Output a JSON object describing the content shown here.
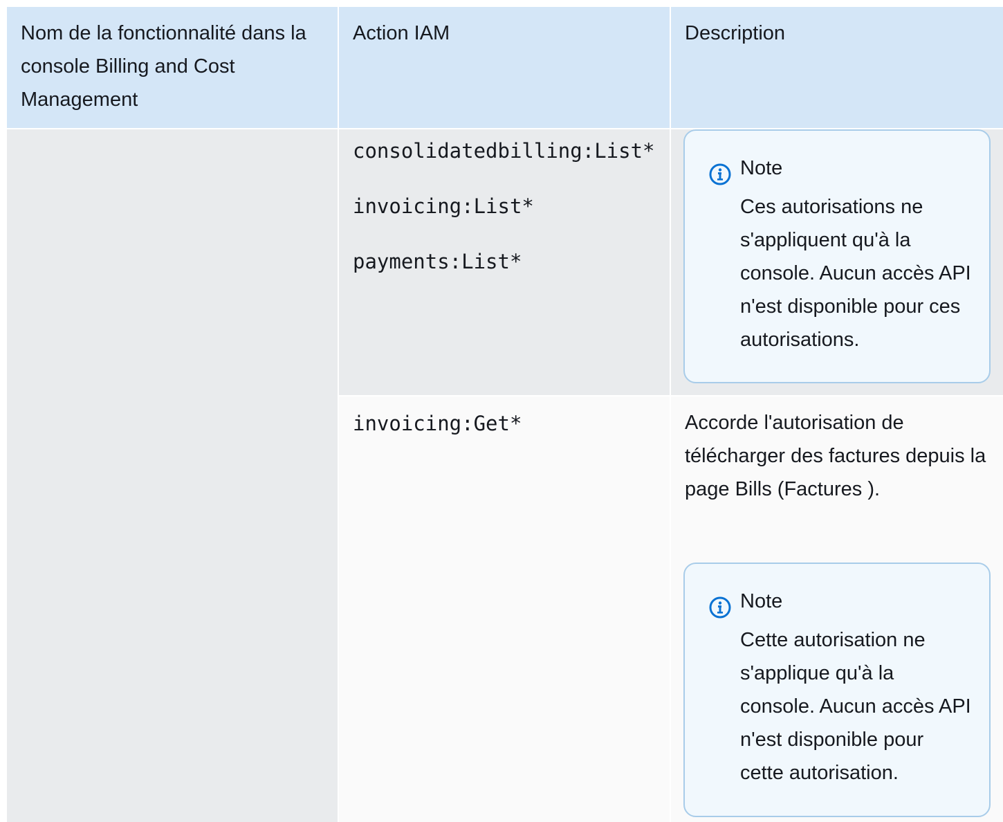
{
  "table": {
    "headers": [
      "Nom de la fonctionnalité dans la console Billing and Cost Management",
      "Action IAM",
      "Description"
    ],
    "rows": [
      {
        "feature": "",
        "actions": [
          "consolidatedbilling:List*",
          "invoicing:List*",
          "payments:List*"
        ],
        "description": "",
        "note": {
          "title": "Note",
          "body": "Ces autorisations ne s'appliquent qu'à la console. Aucun accès API n'est disponible pour ces autorisations."
        }
      },
      {
        "feature": "",
        "actions": [
          "invoicing:Get*"
        ],
        "description": "Accorde l'autorisation de télécharger des factures depuis la page Bills (Factures ).",
        "note": {
          "title": "Note",
          "body": "Cette autorisation ne s'applique qu'à la console. Aucun accès API n'est disponible pour cette autorisation."
        }
      }
    ]
  },
  "colors": {
    "header_bg": "#d4e6f7",
    "row_shaded_bg": "#e9ebed",
    "row_light_bg": "#fafafa",
    "note_border": "#a8cce9",
    "note_bg": "#f1f8fd",
    "info_icon": "#0972d3"
  },
  "icons": {
    "note": "info-icon"
  }
}
